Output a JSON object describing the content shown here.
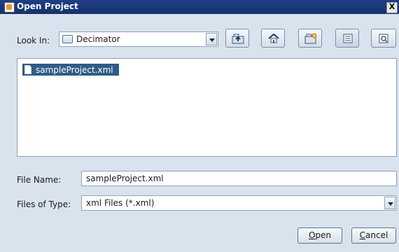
{
  "window": {
    "title": "Open Project",
    "close_glyph": "X"
  },
  "look_in": {
    "label": "Look In:",
    "value": "Decimator"
  },
  "toolbar": {
    "buttons": [
      {
        "icon": "up-folder-icon"
      },
      {
        "icon": "home-icon"
      },
      {
        "icon": "new-folder-icon"
      },
      {
        "icon": "list-view-icon"
      },
      {
        "icon": "details-view-icon"
      }
    ]
  },
  "files": {
    "items": [
      {
        "name": "sampleProject.xml",
        "selected": true
      }
    ]
  },
  "file_name": {
    "label": "File Name:",
    "value": "sampleProject.xml"
  },
  "file_type": {
    "label": "Files of Type:",
    "value": "xml Files (*.xml)"
  },
  "buttons": {
    "open": "Open",
    "cancel": "Cancel"
  }
}
